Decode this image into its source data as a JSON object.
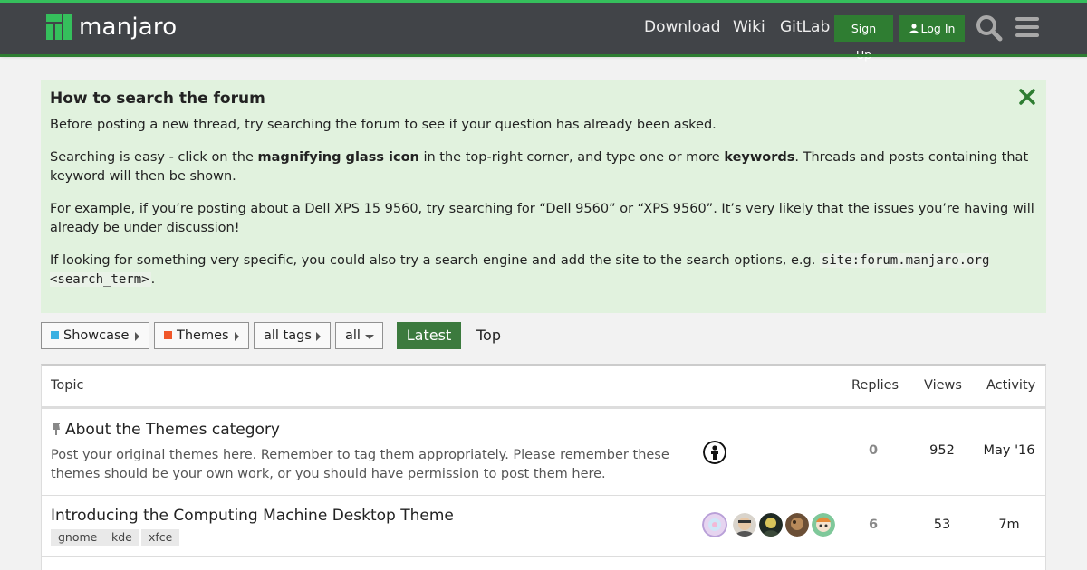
{
  "header": {
    "logo_text": "manjaro",
    "nav": [
      "Download",
      "Wiki",
      "GitLab"
    ],
    "signup_label": "Sign Up",
    "login_label": "Log In",
    "colors": {
      "bar": "#414448",
      "accent": "#35bf5c",
      "button": "#2f7d32"
    }
  },
  "banner": {
    "title": "How to search the forum",
    "p1": "Before posting a new thread, try searching the forum to see if your question has already been asked.",
    "p2_a": "Searching is easy - click on the ",
    "p2_b": "magnifying glass icon",
    "p2_c": " in the top-right corner, and type one or more ",
    "p2_d": "keywords",
    "p2_e": ". Threads and posts containing that keyword will then be shown.",
    "p3": "For example, if you’re posting about a Dell XPS 15 9560, try searching for “Dell 9560” or “XPS 9560”. It’s very likely that the issues you’re having will already be under discussion!",
    "p4_a": "If looking for something very specific, you could also try a search engine and add the site to the search options, e.g. ",
    "p4_code": "site:forum.manjaro.org <search_term>",
    "p4_b": "."
  },
  "filters": {
    "category_parent": "Showcase",
    "category_parent_color": "#3ab0e2",
    "category_child": "Themes",
    "category_child_color": "#f0572a",
    "tags": "all tags",
    "scope": "all",
    "tab_latest": "Latest",
    "tab_top": "Top"
  },
  "table": {
    "headers": {
      "topic": "Topic",
      "replies": "Replies",
      "views": "Views",
      "activity": "Activity"
    },
    "rows": [
      {
        "title": "About the Themes category",
        "pinned": true,
        "excerpt": "Post your original themes here. Remember to tag them appropriately. Please remember these themes should be your own work, or you should have permission to post them here.",
        "replies": "0",
        "views": "952",
        "activity": "May '16"
      },
      {
        "title": "Introducing the Computing Machine Desktop Theme",
        "pinned": false,
        "tags": [
          "gnome",
          "kde",
          "xfce"
        ],
        "replies": "6",
        "views": "53",
        "activity": "7m"
      }
    ]
  }
}
